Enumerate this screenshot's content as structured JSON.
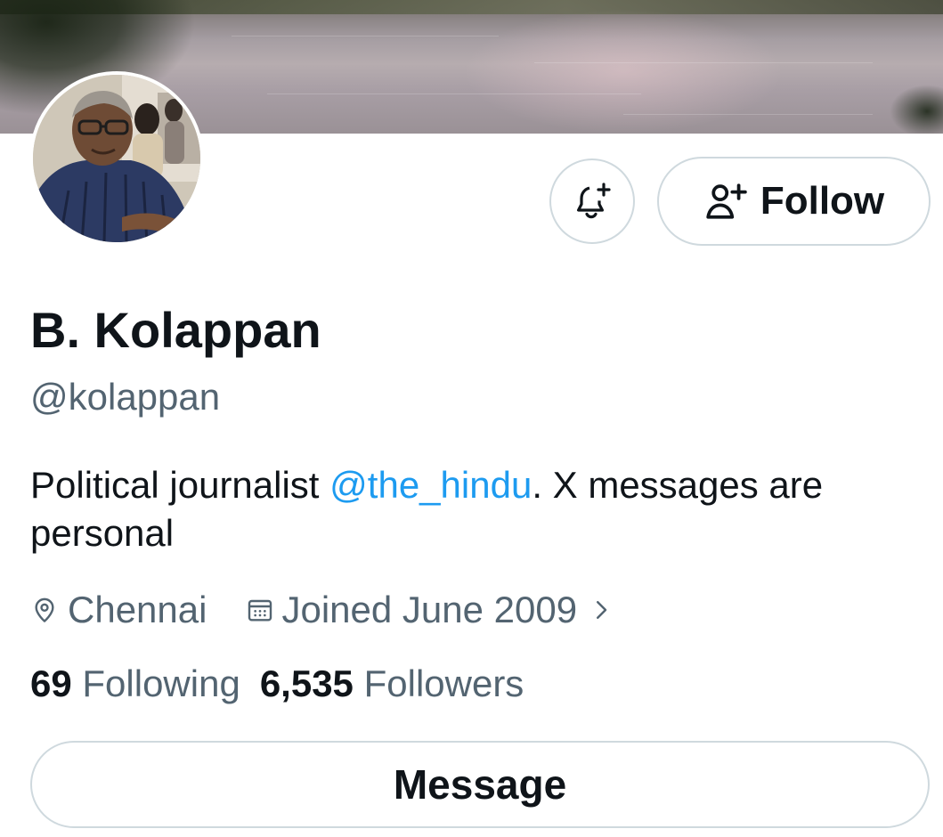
{
  "profile": {
    "name": "B. Kolappan",
    "handle": "@kolappan",
    "bio_prefix": "Political journalist ",
    "bio_mention": "@the_hindu",
    "bio_suffix": ". X messages are personal",
    "location": "Chennai",
    "joined": "Joined June 2009",
    "following_count": "69",
    "following_label": "Following",
    "followers_count": "6,535",
    "followers_label": "Followers"
  },
  "actions": {
    "follow_label": "Follow",
    "message_label": "Message"
  },
  "icons": {
    "notify": "bell-plus-icon",
    "follow": "person-plus-icon",
    "location": "location-pin-icon",
    "calendar": "calendar-icon",
    "chevron": "chevron-right-icon"
  },
  "colors": {
    "text_primary": "#0f1419",
    "text_secondary": "#536471",
    "link": "#1d9bf0",
    "border": "#cfd9de"
  }
}
